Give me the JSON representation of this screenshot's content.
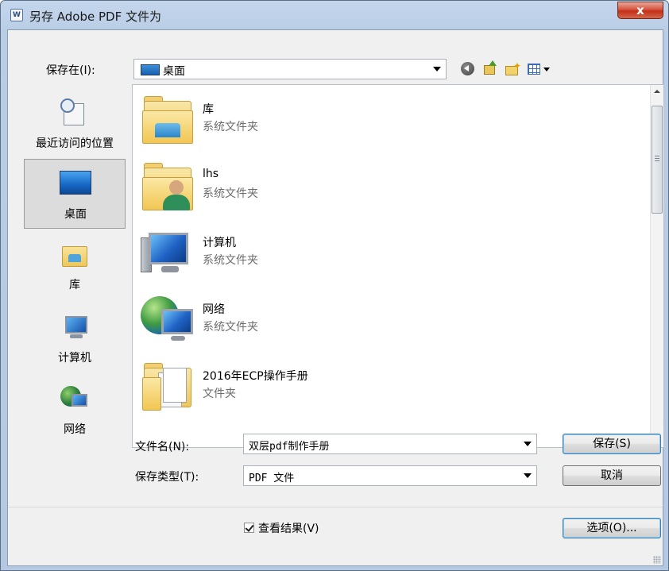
{
  "window": {
    "title": "另存 Adobe PDF 文件为",
    "close_label": "x",
    "icon_glyph": "W"
  },
  "toolbar": {
    "save_in_label": "保存在(I):",
    "save_in_value": "桌面",
    "back_icon": "back-arrow-icon",
    "up_icon": "up-folder-icon",
    "new_folder_icon": "new-folder-icon",
    "view_icon": "view-menu-icon"
  },
  "places": [
    {
      "label": "最近访问的位置",
      "icon": "recent-places-icon"
    },
    {
      "label": "桌面",
      "icon": "desktop-icon",
      "selected": true
    },
    {
      "label": "库",
      "icon": "libraries-icon"
    },
    {
      "label": "计算机",
      "icon": "computer-icon"
    },
    {
      "label": "网络",
      "icon": "network-icon"
    }
  ],
  "files": [
    {
      "name": "库",
      "type": "系统文件夹",
      "icon": "libraries-folder-icon"
    },
    {
      "name": "lhs",
      "type": "系统文件夹",
      "icon": "user-folder-icon"
    },
    {
      "name": "计算机",
      "type": "系统文件夹",
      "icon": "computer-icon"
    },
    {
      "name": "网络",
      "type": "系统文件夹",
      "icon": "network-icon"
    },
    {
      "name": "2016年ECP操作手册",
      "type": "文件夹",
      "icon": "folder-icon"
    }
  ],
  "filename": {
    "label": "文件名(N):",
    "value": "双层pdf制作手册"
  },
  "filetype": {
    "label": "保存类型(T):",
    "value": "PDF 文件"
  },
  "buttons": {
    "save": "保存(S)",
    "cancel": "取消",
    "options": "选项(O)..."
  },
  "view_result": {
    "label": "查看结果(V)",
    "checked": true
  },
  "colors": {
    "titlebar": "#b9cde6",
    "close_button": "#c13017",
    "dialog_bg": "#f0f0f0",
    "selection_bg": "#dcdcdc"
  }
}
